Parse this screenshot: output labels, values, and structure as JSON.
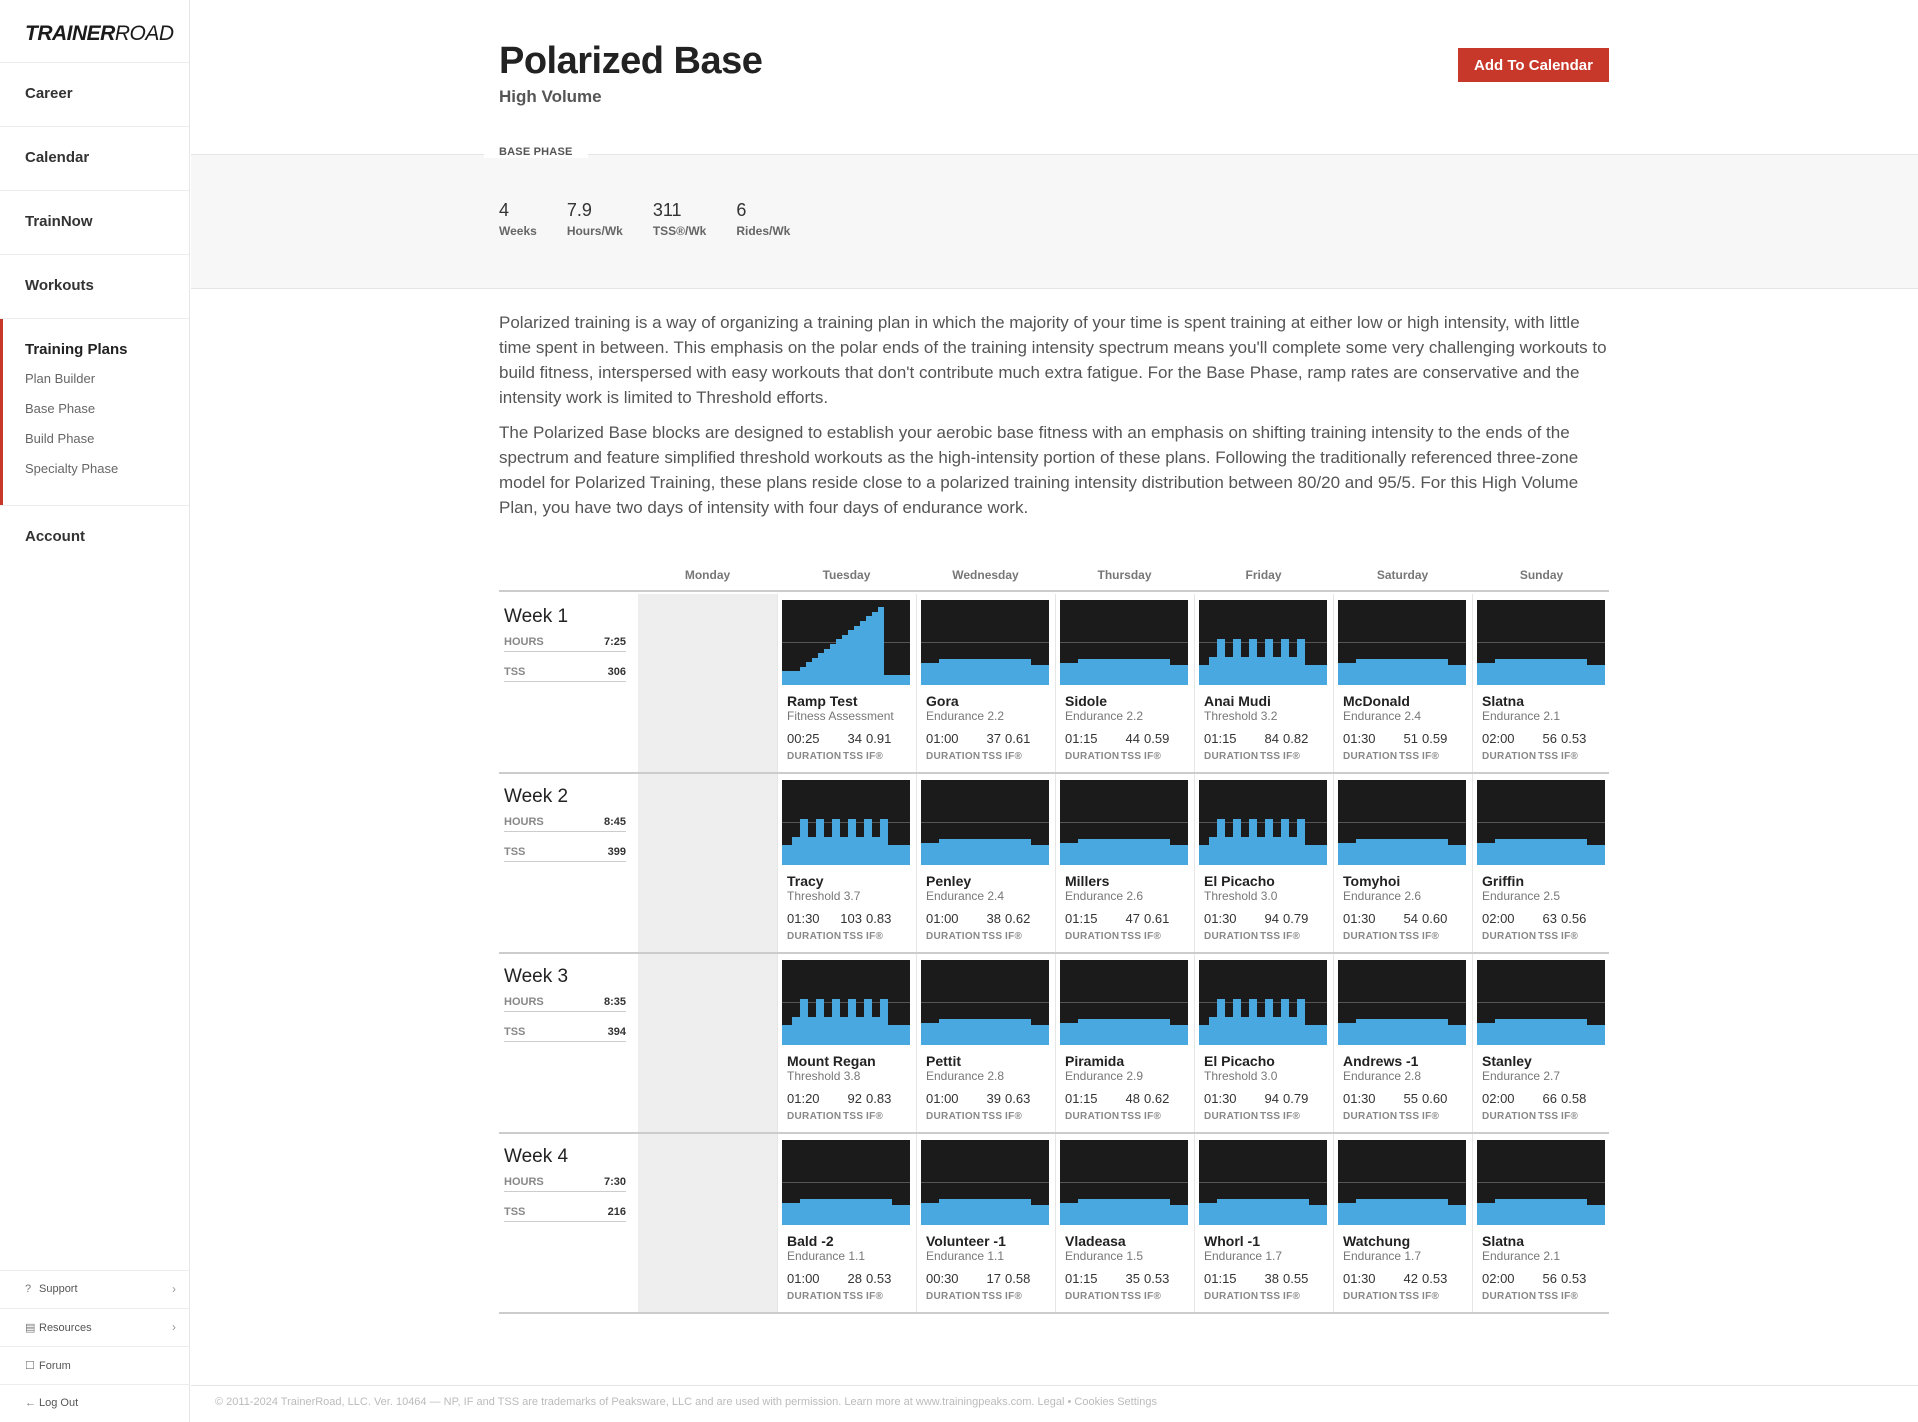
{
  "sidebar": {
    "logo_bold": "TRAINER",
    "logo_light": "ROAD",
    "items": [
      "Career",
      "Calendar",
      "TrainNow",
      "Workouts"
    ],
    "group_title": "Training Plans",
    "sub_items": [
      "Plan Builder",
      "Base Phase",
      "Build Phase",
      "Specialty Phase"
    ],
    "account": "Account",
    "bottom": [
      {
        "label": "Support",
        "icon": "question-circle-icon",
        "glyph": "?",
        "chev": "›"
      },
      {
        "label": "Resources",
        "icon": "list-box-icon",
        "glyph": "▤",
        "chev": "›"
      },
      {
        "label": "Forum",
        "icon": "chat-icon",
        "glyph": "☐",
        "chev": ""
      },
      {
        "label": "Log Out",
        "icon": "arrow-left-icon",
        "glyph": "←",
        "chev": ""
      }
    ]
  },
  "header": {
    "title": "Polarized Base",
    "subtitle": "High Volume",
    "button": "Add To Calendar"
  },
  "phase_label": "BASE PHASE",
  "stats": [
    {
      "value": "4",
      "label": "Weeks"
    },
    {
      "value": "7.9",
      "label": "Hours/Wk"
    },
    {
      "value": "311",
      "label": "TSS®/Wk"
    },
    {
      "value": "6",
      "label": "Rides/Wk"
    }
  ],
  "description": [
    "Polarized training is a way of organizing a training plan in which the majority of your time is spent training at either low or high intensity, with little time spent in between. This emphasis on the polar ends of the training intensity spectrum means you'll complete some very challenging workouts to build fitness, interspersed with easy workouts that don't contribute much extra fatigue. For the Base Phase, ramp rates are conservative and the intensity work is limited to Threshold efforts.",
    "The Polarized Base blocks are designed to establish your aerobic base fitness with an emphasis on shifting training intensity to the ends of the spectrum and feature simplified threshold workouts as the high-intensity portion of these plans. Following the traditionally referenced three-zone model for Polarized Training, these plans reside close to a polarized training intensity distribution between 80/20 and 95/5. For this High Volume Plan, you have two days of intensity with four days of endurance work."
  ],
  "days": [
    "Monday",
    "Tuesday",
    "Wednesday",
    "Thursday",
    "Friday",
    "Saturday",
    "Sunday"
  ],
  "labels": {
    "hours": "HOURS",
    "tss": "TSS",
    "duration": "DURATION",
    "tss_short": "TSS",
    "if": "IF®"
  },
  "colors": {
    "accent": "#c7382b",
    "chart_bg": "#1b1b1b",
    "chart_fill": "#4aa8e0"
  },
  "weeks": [
    {
      "label": "Week 1",
      "hours": "7:25",
      "tss": "306",
      "workouts": [
        {
          "name": "Ramp Test",
          "type": "Fitness Assessment",
          "duration": "00:25",
          "tss": "34",
          "if": "0.91",
          "profile": "ramp"
        },
        {
          "name": "Gora",
          "type": "Endurance 2.2",
          "duration": "01:00",
          "tss": "37",
          "if": "0.61",
          "profile": "endurance"
        },
        {
          "name": "Sidole",
          "type": "Endurance 2.2",
          "duration": "01:15",
          "tss": "44",
          "if": "0.59",
          "profile": "endurance"
        },
        {
          "name": "Anai Mudi",
          "type": "Threshold 3.2",
          "duration": "01:15",
          "tss": "84",
          "if": "0.82",
          "profile": "threshold"
        },
        {
          "name": "McDonald",
          "type": "Endurance 2.4",
          "duration": "01:30",
          "tss": "51",
          "if": "0.59",
          "profile": "endurance"
        },
        {
          "name": "Slatna",
          "type": "Endurance 2.1",
          "duration": "02:00",
          "tss": "56",
          "if": "0.53",
          "profile": "endurance"
        }
      ]
    },
    {
      "label": "Week 2",
      "hours": "8:45",
      "tss": "399",
      "workouts": [
        {
          "name": "Tracy",
          "type": "Threshold 3.7",
          "duration": "01:30",
          "tss": "103",
          "if": "0.83",
          "profile": "threshold"
        },
        {
          "name": "Penley",
          "type": "Endurance 2.4",
          "duration": "01:00",
          "tss": "38",
          "if": "0.62",
          "profile": "endurance"
        },
        {
          "name": "Millers",
          "type": "Endurance 2.6",
          "duration": "01:15",
          "tss": "47",
          "if": "0.61",
          "profile": "endurance"
        },
        {
          "name": "El Picacho",
          "type": "Threshold 3.0",
          "duration": "01:30",
          "tss": "94",
          "if": "0.79",
          "profile": "threshold"
        },
        {
          "name": "Tomyhoi",
          "type": "Endurance 2.6",
          "duration": "01:30",
          "tss": "54",
          "if": "0.60",
          "profile": "endurance"
        },
        {
          "name": "Griffin",
          "type": "Endurance 2.5",
          "duration": "02:00",
          "tss": "63",
          "if": "0.56",
          "profile": "endurance"
        }
      ]
    },
    {
      "label": "Week 3",
      "hours": "8:35",
      "tss": "394",
      "workouts": [
        {
          "name": "Mount Regan",
          "type": "Threshold 3.8",
          "duration": "01:20",
          "tss": "92",
          "if": "0.83",
          "profile": "threshold"
        },
        {
          "name": "Pettit",
          "type": "Endurance 2.8",
          "duration": "01:00",
          "tss": "39",
          "if": "0.63",
          "profile": "endurance"
        },
        {
          "name": "Piramida",
          "type": "Endurance 2.9",
          "duration": "01:15",
          "tss": "48",
          "if": "0.62",
          "profile": "endurance"
        },
        {
          "name": "El Picacho",
          "type": "Threshold 3.0",
          "duration": "01:30",
          "tss": "94",
          "if": "0.79",
          "profile": "threshold"
        },
        {
          "name": "Andrews -1",
          "type": "Endurance 2.8",
          "duration": "01:30",
          "tss": "55",
          "if": "0.60",
          "profile": "endurance"
        },
        {
          "name": "Stanley",
          "type": "Endurance 2.7",
          "duration": "02:00",
          "tss": "66",
          "if": "0.58",
          "profile": "endurance"
        }
      ]
    },
    {
      "label": "Week 4",
      "hours": "7:30",
      "tss": "216",
      "workouts": [
        {
          "name": "Bald -2",
          "type": "Endurance 1.1",
          "duration": "01:00",
          "tss": "28",
          "if": "0.53",
          "profile": "endurance"
        },
        {
          "name": "Volunteer -1",
          "type": "Endurance 1.1",
          "duration": "00:30",
          "tss": "17",
          "if": "0.58",
          "profile": "endurance"
        },
        {
          "name": "Vladeasa",
          "type": "Endurance 1.5",
          "duration": "01:15",
          "tss": "35",
          "if": "0.53",
          "profile": "endurance"
        },
        {
          "name": "Whorl -1",
          "type": "Endurance 1.7",
          "duration": "01:15",
          "tss": "38",
          "if": "0.55",
          "profile": "endurance"
        },
        {
          "name": "Watchung",
          "type": "Endurance 1.7",
          "duration": "01:30",
          "tss": "42",
          "if": "0.53",
          "profile": "endurance"
        },
        {
          "name": "Slatna",
          "type": "Endurance 2.1",
          "duration": "02:00",
          "tss": "56",
          "if": "0.53",
          "profile": "endurance"
        }
      ]
    }
  ],
  "footer": "© 2011-2024 TrainerRoad, LLC. Ver. 10464 — NP, IF and TSS are trademarks of Peaksware, LLC and are used with permission. Learn more at www.trainingpeaks.com. Legal • Cookies Settings"
}
